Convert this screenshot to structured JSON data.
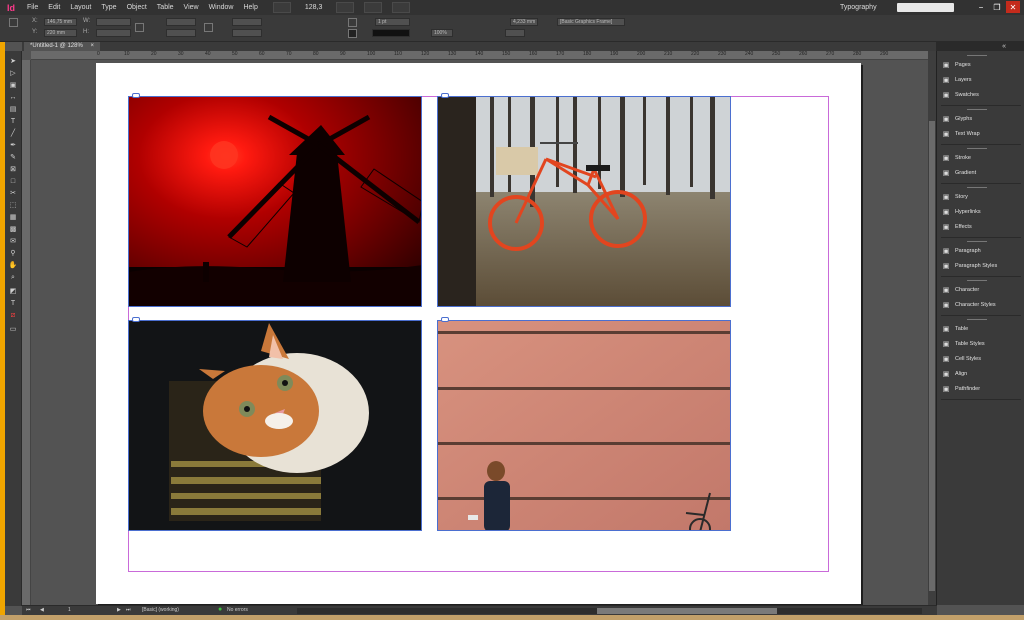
{
  "menubar": {
    "logo": "Id",
    "items": [
      "File",
      "Edit",
      "Layout",
      "Type",
      "Object",
      "Table",
      "View",
      "Window",
      "Help"
    ],
    "zoom": "128,3",
    "workspace": "Typography"
  },
  "control_panel": {
    "x_label": "X:",
    "x_value": "146,75 mm",
    "y_label": "Y:",
    "y_value": "220 mm",
    "w_label": "W:",
    "h_label": "H:",
    "stroke_weight": "1 pt",
    "opacity": "100%",
    "size_value": "4,233 mm",
    "object_style": "[Basic Graphics Frame]"
  },
  "document_tab": {
    "title": "*Untitled-1 @ 128%",
    "close": "×"
  },
  "ruler": {
    "h_ticks": [
      "0",
      "10",
      "20",
      "30",
      "40",
      "50",
      "60",
      "70",
      "80",
      "90",
      "100",
      "110",
      "120",
      "130",
      "140",
      "150",
      "160",
      "170",
      "180",
      "190",
      "200",
      "210",
      "220",
      "230",
      "240",
      "250",
      "260",
      "270",
      "280",
      "290"
    ]
  },
  "images": [
    {
      "subject": "windmill-red-sky",
      "colors": [
        "#c00000",
        "#ff2a1a",
        "#0a0000"
      ]
    },
    {
      "subject": "orange-bicycle-birch-forest",
      "colors": [
        "#e04a20",
        "#8a7a5a",
        "#c8c8c8"
      ]
    },
    {
      "subject": "ginger-cat",
      "colors": [
        "#c97a3c",
        "#f4ece0",
        "#1a1a1a"
      ]
    },
    {
      "subject": "woman-wooden-wall",
      "colors": [
        "#c47b6a",
        "#e09a87",
        "#5a3d33"
      ]
    }
  ],
  "panels": [
    {
      "label": "Pages",
      "icon": "pages-icon"
    },
    {
      "label": "Layers",
      "icon": "layers-icon"
    },
    {
      "label": "Swatches",
      "icon": "swatches-icon"
    },
    {
      "label": "Glyphs",
      "icon": "glyphs-icon"
    },
    {
      "label": "Text Wrap",
      "icon": "text-wrap-icon"
    },
    {
      "label": "Stroke",
      "icon": "stroke-icon"
    },
    {
      "label": "Gradient",
      "icon": "gradient-icon"
    },
    {
      "label": "Story",
      "icon": "story-icon"
    },
    {
      "label": "Hyperlinks",
      "icon": "hyperlinks-icon"
    },
    {
      "label": "Effects",
      "icon": "effects-icon"
    },
    {
      "label": "Paragraph",
      "icon": "paragraph-icon"
    },
    {
      "label": "Paragraph Styles",
      "icon": "paragraph-styles-icon"
    },
    {
      "label": "Character",
      "icon": "character-icon"
    },
    {
      "label": "Character Styles",
      "icon": "character-styles-icon"
    },
    {
      "label": "Table",
      "icon": "table-icon"
    },
    {
      "label": "Table Styles",
      "icon": "table-styles-icon"
    },
    {
      "label": "Cell Styles",
      "icon": "cell-styles-icon"
    },
    {
      "label": "Align",
      "icon": "align-icon"
    },
    {
      "label": "Pathfinder",
      "icon": "pathfinder-icon"
    }
  ],
  "statusbar": {
    "page": "1",
    "preflight_profile": "[Basic] (working)",
    "errors": "No errors"
  },
  "colors": {
    "accent_pink": "#ff3a8c",
    "frame_blue": "#4b6fd0",
    "margin_magenta": "#c96ad9",
    "ok_green": "#3ec13e"
  }
}
